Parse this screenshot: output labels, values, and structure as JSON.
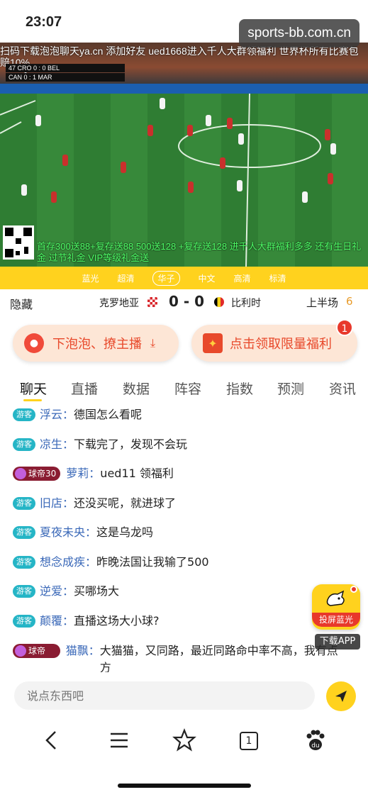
{
  "status": {
    "time": "23:07"
  },
  "watermark": "sports-bb.com.cn",
  "video": {
    "ticker": "扫码下载泡泡聊天ya.cn 添加好友 ued1668进入千人大群领福利 世界杯所有比赛包赔10%",
    "scorebug_line1": "CRO 0 : 0 BEL",
    "scorebug_line2": "CAN 0 : 1 MAR",
    "scorebug_time": "47",
    "bottom_ad": "首存300送88+复存送88 500送128 +复存送128 进千人大群福利多多 还有生日礼金 过节礼金 VIP等级礼金送"
  },
  "quality": {
    "options": [
      "蓝光",
      "超清",
      "华子",
      "中文",
      "高清",
      "标清"
    ],
    "active_index": 2
  },
  "match": {
    "hide_label": "隐藏",
    "team_home": "克罗地亚",
    "score": "0 - 0",
    "team_away": "比利时",
    "period": "上半场",
    "minute": "6"
  },
  "promos": {
    "left_label": "下泡泡、撩主播",
    "right_label": "点击领取限量福利",
    "right_badge": "1"
  },
  "tabs": [
    "聊天",
    "直播",
    "数据",
    "阵容",
    "指数",
    "预测",
    "资讯"
  ],
  "chat": {
    "guest_tag": "游客",
    "vip_tag": "球帝30",
    "messages": [
      {
        "type": "guest",
        "name": "浮云：",
        "text": "德国怎么看呢"
      },
      {
        "type": "guest",
        "name": "凉生：",
        "text": "下载完了，发现不会玩"
      },
      {
        "type": "vip",
        "name": "萝莉：",
        "text": "ued11 领福利"
      },
      {
        "type": "guest",
        "name": "旧店：",
        "text": "还没买呢，就进球了"
      },
      {
        "type": "guest",
        "name": "夏夜未央：",
        "text": "这是乌龙吗"
      },
      {
        "type": "guest",
        "name": "想念成疾：",
        "text": "昨晚法国让我输了500"
      },
      {
        "type": "guest",
        "name": "逆爱：",
        "text": "买哪场大"
      },
      {
        "type": "guest",
        "name": "颠覆：",
        "text": "直播这场大小球?"
      },
      {
        "type": "vip",
        "name": "猫飘：",
        "text": "大猫猫，又同路，最近同路命中率不高，我有点方"
      }
    ]
  },
  "float_app": {
    "label": "投屏蓝光",
    "download": "下载APP"
  },
  "input": {
    "placeholder": "说点东西吧"
  },
  "browser": {
    "tab_count": "1"
  },
  "colors": {
    "accent": "#ffd21e",
    "promo_red": "#e8492b",
    "guest_tag": "#25b5c6",
    "vip_tag": "#8a1c32",
    "name_blue": "#3a68b8"
  }
}
